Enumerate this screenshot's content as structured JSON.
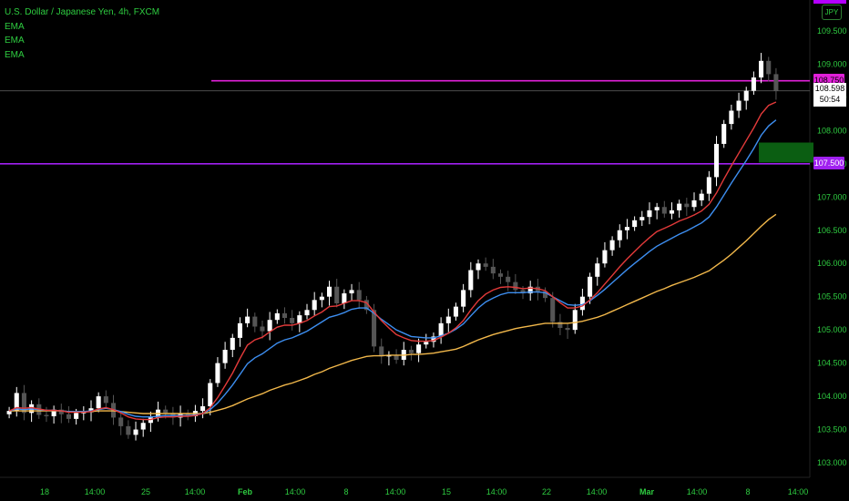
{
  "window": {
    "title": "U.S. Dollar / Japanese Yen, 4h, FXCM",
    "indicators": [
      "EMA",
      "EMA",
      "EMA"
    ],
    "currency": "JPY",
    "current_price": "108.598",
    "countdown": "50:54"
  },
  "colors": {
    "background": "#000000",
    "bull_candle": "#ffffff",
    "bear_candle": "#555555",
    "ema_fast": "#e33a3a",
    "ema_mid": "#3d8ef0",
    "ema_slow": "#f2b84b",
    "level_upper": "#e020d8",
    "level_lower": "#a020f0",
    "zone": "#0b5e12",
    "axis_text": "#2ecc40"
  },
  "chart_data": {
    "type": "candlestick",
    "title": "U.S. Dollar / Japanese Yen, 4h, FXCM",
    "y_axis": {
      "ticks": [
        "109.500",
        "109.000",
        "108.500",
        "108.000",
        "107.500",
        "107.000",
        "106.500",
        "106.000",
        "105.500",
        "105.000",
        "104.500",
        "104.000",
        "103.500",
        "103.000"
      ],
      "ylim": [
        102.9,
        109.95
      ]
    },
    "x_axis": {
      "ticks": [
        "18",
        "14:00",
        "25",
        "14:00",
        "Feb",
        "14:00",
        "8",
        "14:00",
        "15",
        "14:00",
        "22",
        "14:00",
        "Mar",
        "14:00",
        "8",
        "14:00"
      ]
    },
    "closes": [
      103.78,
      104.05,
      103.75,
      103.88,
      103.72,
      103.7,
      103.8,
      103.73,
      103.66,
      103.75,
      103.76,
      103.82,
      104.0,
      103.9,
      103.68,
      103.55,
      103.42,
      103.5,
      103.6,
      103.68,
      103.8,
      103.75,
      103.68,
      103.74,
      103.7,
      103.78,
      103.85,
      104.2,
      104.5,
      104.7,
      104.88,
      105.1,
      105.2,
      105.05,
      104.98,
      105.15,
      105.25,
      105.18,
      105.1,
      105.22,
      105.3,
      105.45,
      105.5,
      105.65,
      105.4,
      105.55,
      105.6,
      105.45,
      105.3,
      104.75,
      104.6,
      104.62,
      104.55,
      104.7,
      104.65,
      104.78,
      104.82,
      104.9,
      105.1,
      105.2,
      105.35,
      105.6,
      105.9,
      106.0,
      105.95,
      105.85,
      105.8,
      105.72,
      105.6,
      105.55,
      105.65,
      105.58,
      105.48,
      105.12,
      105.03,
      105.0,
      105.3,
      105.5,
      105.8,
      106.0,
      106.2,
      106.35,
      106.5,
      106.55,
      106.65,
      106.7,
      106.8,
      106.85,
      106.75,
      106.8,
      106.9,
      106.85,
      106.95,
      107.05,
      107.3,
      107.8,
      108.1,
      108.3,
      108.45,
      108.6,
      108.8,
      109.05,
      108.85,
      108.6
    ],
    "ema_fast": [
      103.78,
      103.83,
      103.82,
      103.83,
      103.81,
      103.79,
      103.79,
      103.78,
      103.76,
      103.76,
      103.76,
      103.77,
      103.81,
      103.83,
      103.8,
      103.75,
      103.69,
      103.66,
      103.65,
      103.65,
      103.68,
      103.69,
      103.69,
      103.7,
      103.7,
      103.71,
      103.74,
      103.83,
      103.98,
      104.16,
      104.35,
      104.57,
      104.77,
      104.85,
      104.89,
      104.97,
      105.04,
      105.07,
      105.07,
      105.1,
      105.14,
      105.21,
      105.27,
      105.35,
      105.36,
      105.4,
      105.44,
      105.44,
      105.41,
      105.27,
      105.14,
      105.03,
      104.93,
      104.88,
      104.84,
      104.83,
      104.83,
      104.84,
      104.89,
      104.95,
      105.03,
      105.14,
      105.3,
      105.44,
      105.54,
      105.6,
      105.64,
      105.65,
      105.64,
      105.62,
      105.63,
      105.62,
      105.59,
      105.5,
      105.41,
      105.33,
      105.33,
      105.36,
      105.45,
      105.56,
      105.69,
      105.82,
      105.95,
      106.07,
      106.18,
      106.29,
      106.39,
      106.48,
      106.53,
      106.58,
      106.64,
      106.68,
      106.73,
      106.79,
      106.89,
      107.06,
      107.27,
      107.47,
      107.66,
      107.85,
      108.04,
      108.25,
      108.38,
      108.43
    ],
    "ema_mid": [
      103.78,
      103.81,
      103.8,
      103.81,
      103.8,
      103.79,
      103.79,
      103.78,
      103.77,
      103.77,
      103.77,
      103.78,
      103.8,
      103.82,
      103.8,
      103.77,
      103.73,
      103.7,
      103.69,
      103.69,
      103.7,
      103.71,
      103.71,
      103.71,
      103.71,
      103.72,
      103.74,
      103.8,
      103.9,
      104.03,
      104.17,
      104.33,
      104.49,
      104.58,
      104.64,
      104.72,
      104.8,
      104.85,
      104.88,
      104.93,
      104.98,
      105.05,
      105.12,
      105.19,
      105.22,
      105.26,
      105.31,
      105.33,
      105.33,
      105.25,
      105.16,
      105.08,
      105.0,
      104.95,
      104.9,
      104.89,
      104.88,
      104.88,
      104.91,
      104.95,
      105.01,
      105.09,
      105.21,
      105.33,
      105.42,
      105.48,
      105.53,
      105.56,
      105.56,
      105.56,
      105.57,
      105.57,
      105.56,
      105.5,
      105.44,
      105.38,
      105.37,
      105.38,
      105.44,
      105.52,
      105.61,
      105.71,
      105.81,
      105.91,
      106.0,
      106.09,
      106.18,
      106.26,
      106.32,
      106.38,
      106.44,
      106.49,
      106.55,
      106.61,
      106.7,
      106.85,
      107.03,
      107.21,
      107.38,
      107.55,
      107.73,
      107.93,
      108.07,
      108.16
    ],
    "ema_slow": [
      103.78,
      103.78,
      103.78,
      103.78,
      103.78,
      103.78,
      103.78,
      103.78,
      103.77,
      103.77,
      103.77,
      103.77,
      103.78,
      103.78,
      103.78,
      103.77,
      103.76,
      103.75,
      103.74,
      103.74,
      103.74,
      103.74,
      103.74,
      103.74,
      103.74,
      103.74,
      103.74,
      103.76,
      103.79,
      103.82,
      103.86,
      103.91,
      103.96,
      104.0,
      104.04,
      104.09,
      104.13,
      104.17,
      104.2,
      104.24,
      104.28,
      104.33,
      104.37,
      104.42,
      104.46,
      104.5,
      104.54,
      104.57,
      104.6,
      104.61,
      104.61,
      104.62,
      104.62,
      104.62,
      104.63,
      104.63,
      104.64,
      104.65,
      104.67,
      104.69,
      104.71,
      104.75,
      104.8,
      104.85,
      104.89,
      104.93,
      104.96,
      104.99,
      105.02,
      105.04,
      105.06,
      105.08,
      105.1,
      105.1,
      105.1,
      105.1,
      105.11,
      105.13,
      105.16,
      105.19,
      105.23,
      105.28,
      105.33,
      105.38,
      105.43,
      105.48,
      105.53,
      105.58,
      105.62,
      105.67,
      105.71,
      105.75,
      105.79,
      105.84,
      105.89,
      105.97,
      106.05,
      106.14,
      106.24,
      106.34,
      106.45,
      106.56,
      106.66,
      106.74
    ],
    "levels": [
      {
        "label": "108.750",
        "value": 108.75
      },
      {
        "label": "107.500",
        "value": 107.5
      }
    ],
    "zone": {
      "low": 107.52,
      "high": 107.82
    }
  }
}
